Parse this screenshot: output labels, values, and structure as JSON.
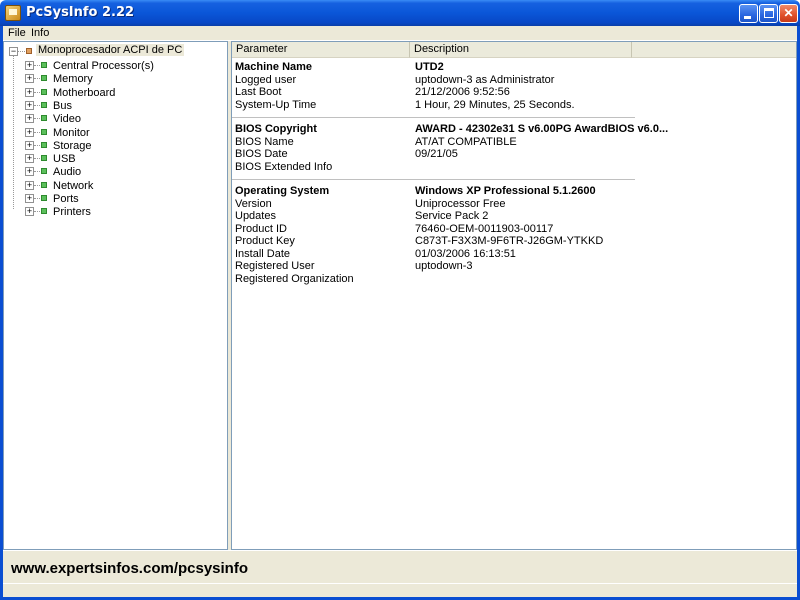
{
  "window": {
    "title": "PcSysInfo 2.22",
    "minimize_glyph": "",
    "maximize_glyph": "",
    "close_glyph": "✕"
  },
  "menu": [
    "File",
    "Info"
  ],
  "tree": {
    "root": "Monoprocesador ACPI de PC",
    "root_expander": "−",
    "child_expander": "+",
    "children": [
      "Central Processor(s)",
      "Memory",
      "Motherboard",
      "Bus",
      "Video",
      "Monitor",
      "Storage",
      "USB",
      "Audio",
      "Network",
      "Ports",
      "Printers"
    ]
  },
  "list": {
    "headers": {
      "parameter": "Parameter",
      "description": "Description"
    },
    "groups": [
      [
        {
          "param": "Machine Name",
          "value": "UTD2",
          "bold": true
        },
        {
          "param": "Logged user",
          "value": "uptodown-3 as Administrator"
        },
        {
          "param": "Last Boot",
          "value": "21/12/2006 9:52:56"
        },
        {
          "param": "System-Up Time",
          "value": "1 Hour, 29 Minutes, 25 Seconds."
        }
      ],
      [
        {
          "param": "BIOS Copyright",
          "value": "AWARD  - 42302e31 S v6.00PG AwardBIOS v6.0...",
          "bold": true
        },
        {
          "param": "BIOS Name",
          "value": "AT/AT COMPATIBLE"
        },
        {
          "param": "BIOS Date",
          "value": "09/21/05"
        },
        {
          "param": "BIOS Extended Info",
          "value": ""
        }
      ],
      [
        {
          "param": "Operating System",
          "value": "Windows XP Professional 5.1.2600",
          "bold": true
        },
        {
          "param": "Version",
          "value": "Uniprocessor Free"
        },
        {
          "param": "Updates",
          "value": "Service Pack 2"
        },
        {
          "param": "Product ID",
          "value": "76460-OEM-0011903-00117"
        },
        {
          "param": "Product Key",
          "value": "C873T-F3X3M-9F6TR-J26GM-YTKKD"
        },
        {
          "param": "Install Date",
          "value": "01/03/2006 16:13:51"
        },
        {
          "param": "Registered User",
          "value": "uptodown-3"
        },
        {
          "param": "Registered Organization",
          "value": ""
        }
      ]
    ]
  },
  "banner": {
    "text": "www.expertsinfos.com/pcsysinfo"
  },
  "colors": {
    "titlebar": "#0a56d8",
    "chrome": "#ece9d8",
    "border": "#7f9db9"
  }
}
